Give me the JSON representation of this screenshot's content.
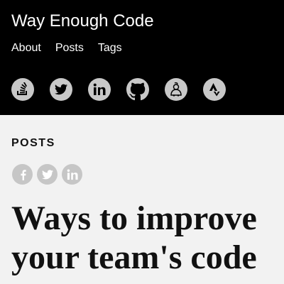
{
  "header": {
    "site_title": "Way Enough Code",
    "nav": [
      {
        "label": "About"
      },
      {
        "label": "Posts"
      },
      {
        "label": "Tags"
      }
    ],
    "social_icons": [
      "stackoverflow-icon",
      "twitter-icon",
      "linkedin-icon",
      "github-icon",
      "keybase-icon",
      "strava-icon"
    ]
  },
  "main": {
    "section_label": "POSTS",
    "share_icons": [
      "facebook-icon",
      "twitter-icon",
      "linkedin-icon"
    ],
    "post_title": "Ways to improve your team's code"
  },
  "colors": {
    "header_background": "#000000",
    "page_background": "#f2f2f2",
    "icon_circle": "#c8c8c8"
  }
}
